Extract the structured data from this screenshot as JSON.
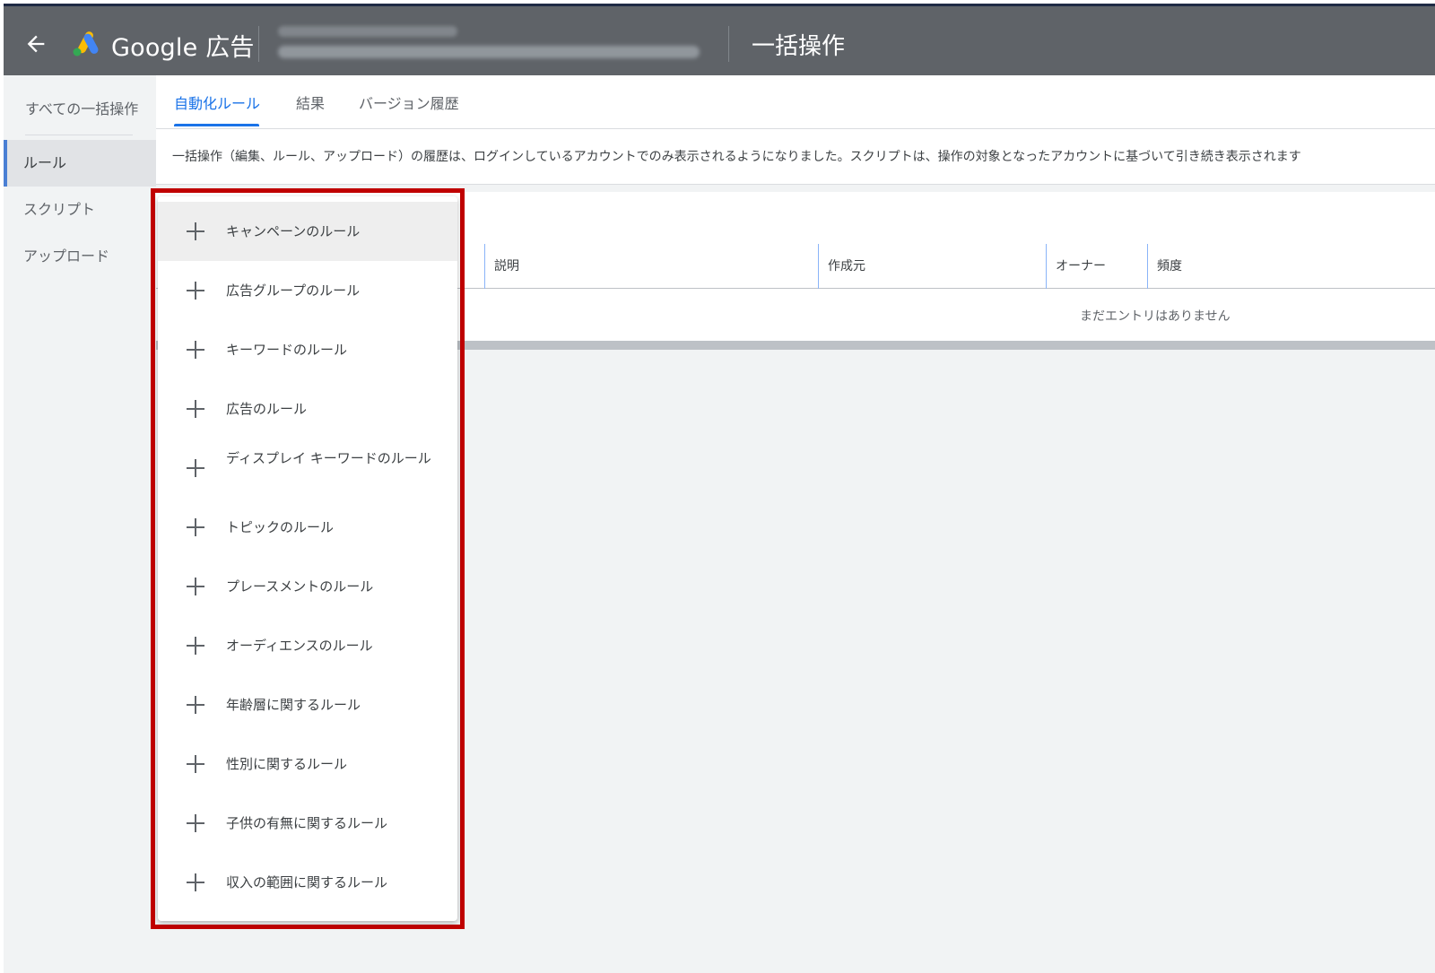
{
  "header": {
    "back_icon": "arrow-back-icon",
    "logo_icon": "google-ads-logo",
    "brand": "Google 広告",
    "account_name": "",
    "account_detail": "",
    "page_title": "一括操作"
  },
  "sidebar": {
    "top_link": "すべての一括操作",
    "items": [
      {
        "label": "ルール",
        "active": true
      },
      {
        "label": "スクリプト",
        "active": false
      },
      {
        "label": "アップロード",
        "active": false
      }
    ]
  },
  "tabs": [
    {
      "label": "自動化ルール",
      "active": true
    },
    {
      "label": "結果",
      "active": false
    },
    {
      "label": "バージョン履歴",
      "active": false
    }
  ],
  "notice": "一括操作（編集、ルール、アップロード）の履歴は、ログインしているアカウントでのみ表示されるようになりました。スクリプトは、操作の対象となったアカウントに基づいて引き続き表示されます",
  "table": {
    "columns": [
      "説明",
      "作成元",
      "オーナー",
      "頻度"
    ],
    "empty_message": "まだエントリはありません"
  },
  "rule_menu": {
    "items": [
      "キャンペーンのルール",
      "広告グループのルール",
      "キーワードのルール",
      "広告のルール",
      "ディスプレイ キーワードのルール",
      "トピックのルール",
      "プレースメントのルール",
      "オーディエンスのルール",
      "年齢層に関するルール",
      "性別に関するルール",
      "子供の有無に関するルール",
      "収入の範囲に関するルール"
    ],
    "item_icon": "plus-icon"
  },
  "colors": {
    "header_bg": "#5f6368",
    "accent": "#1a73e8",
    "highlight_border": "#c00000"
  }
}
